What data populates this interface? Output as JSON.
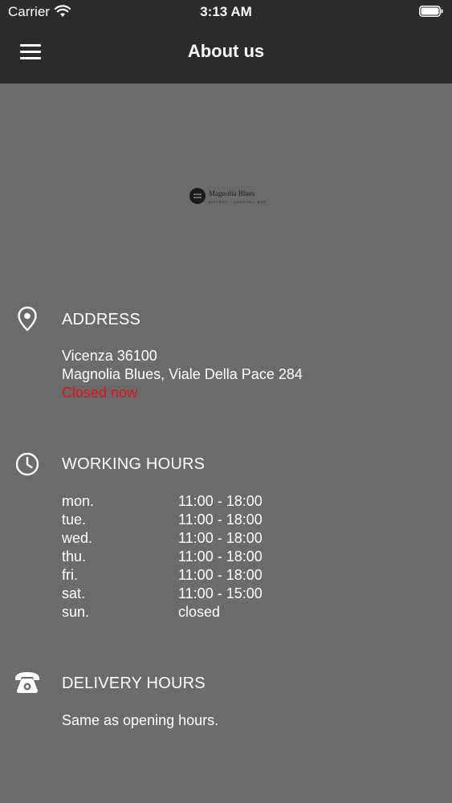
{
  "status_bar": {
    "carrier": "Carrier",
    "time": "3:13 AM"
  },
  "header": {
    "title": "About us",
    "menu_icon": "hamburger-menu-icon"
  },
  "logo": {
    "name": "Magnolia Blues",
    "tagline": "BISTROT · COCKTAIL BAR"
  },
  "address": {
    "title": "ADDRESS",
    "line1": "Vicenza 36100",
    "line2": "Magnolia Blues, Viale Della Pace 284",
    "status": "Closed now",
    "status_color": "#e0141b"
  },
  "working_hours": {
    "title": "WORKING HOURS",
    "rows": [
      {
        "day": "mon.",
        "hours": "11:00 - 18:00"
      },
      {
        "day": "tue.",
        "hours": "11:00 - 18:00"
      },
      {
        "day": "wed.",
        "hours": "11:00 - 18:00"
      },
      {
        "day": "thu.",
        "hours": "11:00 - 18:00"
      },
      {
        "day": "fri.",
        "hours": "11:00 - 18:00"
      },
      {
        "day": "sat.",
        "hours": "11:00 - 15:00"
      },
      {
        "day": "sun.",
        "hours": "closed"
      }
    ]
  },
  "delivery_hours": {
    "title": "DELIVERY HOURS",
    "text": "Same as opening hours."
  },
  "colors": {
    "header_bg": "#2b2a2c",
    "page_bg": "#6b6a6d",
    "text": "#ffffff",
    "alert": "#e0141b"
  }
}
